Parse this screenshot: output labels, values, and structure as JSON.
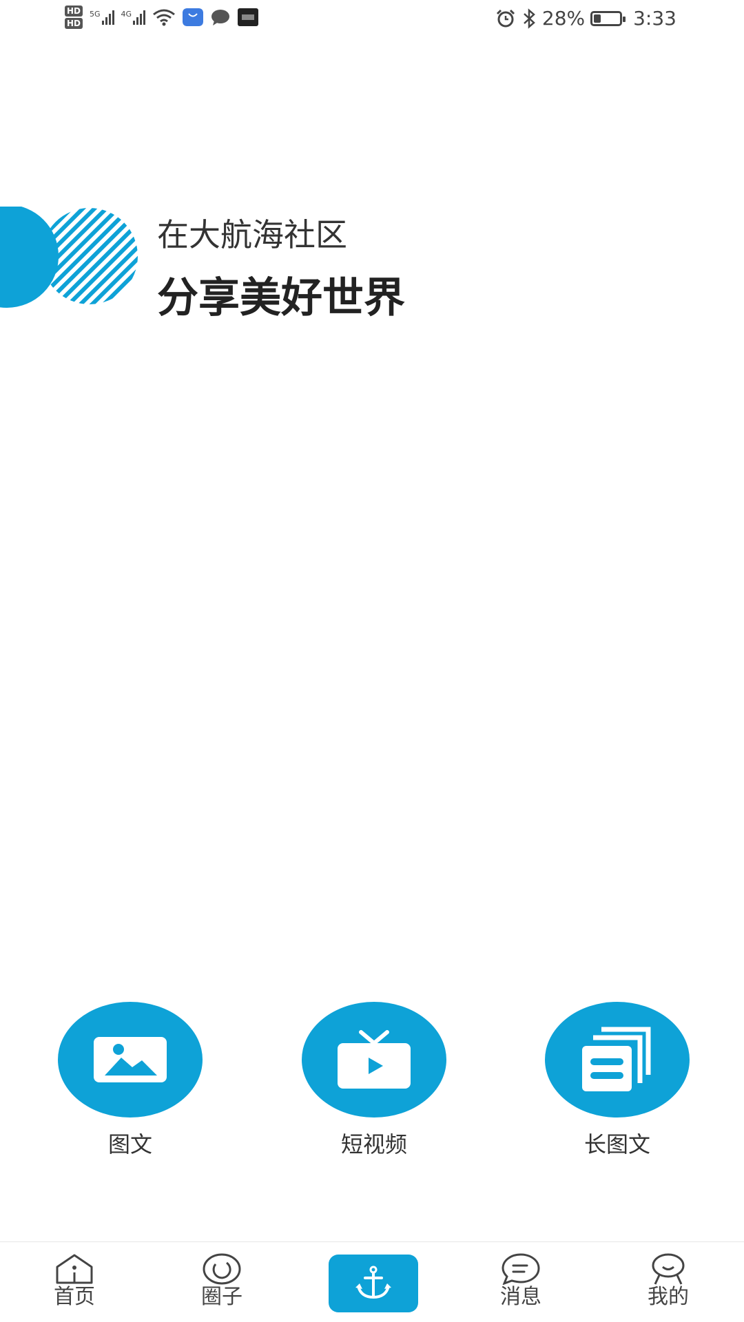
{
  "status_bar": {
    "hd1": "HD",
    "hd2": "HD",
    "net1": "5G",
    "net2": "4G",
    "battery_pct": "28%",
    "battery_level": 0.28,
    "time": "3:33",
    "icons": [
      "wifi-icon",
      "app-store-icon",
      "chat-bubble-icon",
      "soul-app-icon",
      "alarm-icon",
      "bluetooth-icon",
      "battery-icon"
    ]
  },
  "hero": {
    "line1": "在大航海社区",
    "line2": "分享美好世界"
  },
  "publish_options": [
    {
      "label": "图文",
      "icon": "image-icon"
    },
    {
      "label": "短视频",
      "icon": "tv-play-icon"
    },
    {
      "label": "长图文",
      "icon": "long-article-icon"
    }
  ],
  "tab_bar": {
    "items": [
      {
        "label": "首页",
        "icon": "home-icon"
      },
      {
        "label": "圈子",
        "icon": "circle-icon"
      },
      {
        "label": "",
        "icon": "anchor-icon"
      },
      {
        "label": "消息",
        "icon": "message-icon"
      },
      {
        "label": "我的",
        "icon": "profile-icon"
      }
    ]
  },
  "colors": {
    "accent": "#0ea2d7",
    "text": "#222222"
  }
}
